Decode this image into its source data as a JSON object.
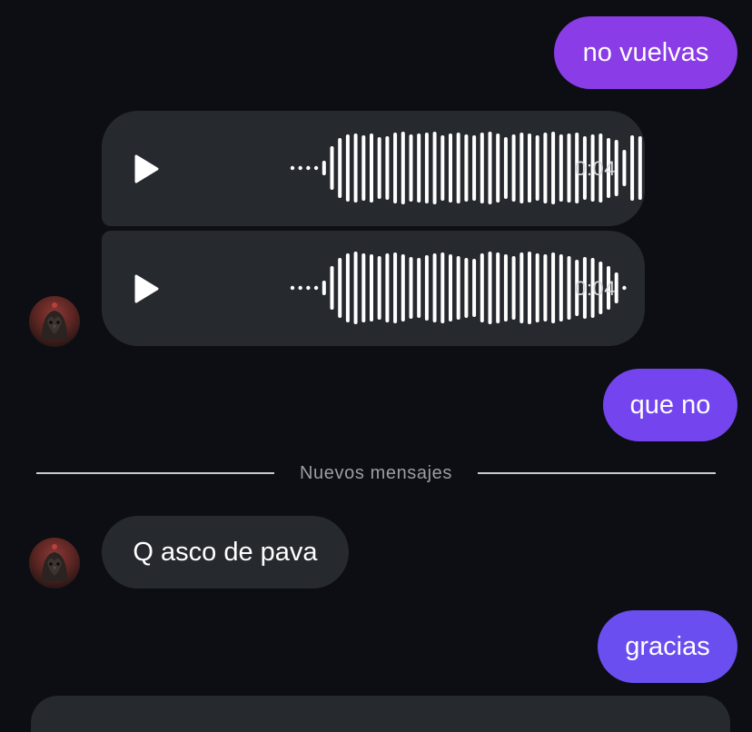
{
  "colors": {
    "background": "#0c0e13",
    "incoming_bubble": "#26292e",
    "outgoing_top": "#8a3ce6",
    "outgoing_bottom": "#6a4ef0",
    "text": "#ffffff",
    "secondary_text": "#9a9da3"
  },
  "messages": {
    "m1": {
      "text": "no vuelvas",
      "direction": "outgoing"
    },
    "voice1": {
      "duration": "0:04",
      "icon": "play-icon"
    },
    "voice2": {
      "duration": "0:04",
      "icon": "play-icon"
    },
    "m2": {
      "text": "que no",
      "direction": "outgoing"
    },
    "m3": {
      "text": "Q asco de pava",
      "direction": "incoming"
    },
    "m4": {
      "text": "gracias",
      "direction": "outgoing"
    }
  },
  "divider": {
    "label": "Nuevos mensajes"
  }
}
